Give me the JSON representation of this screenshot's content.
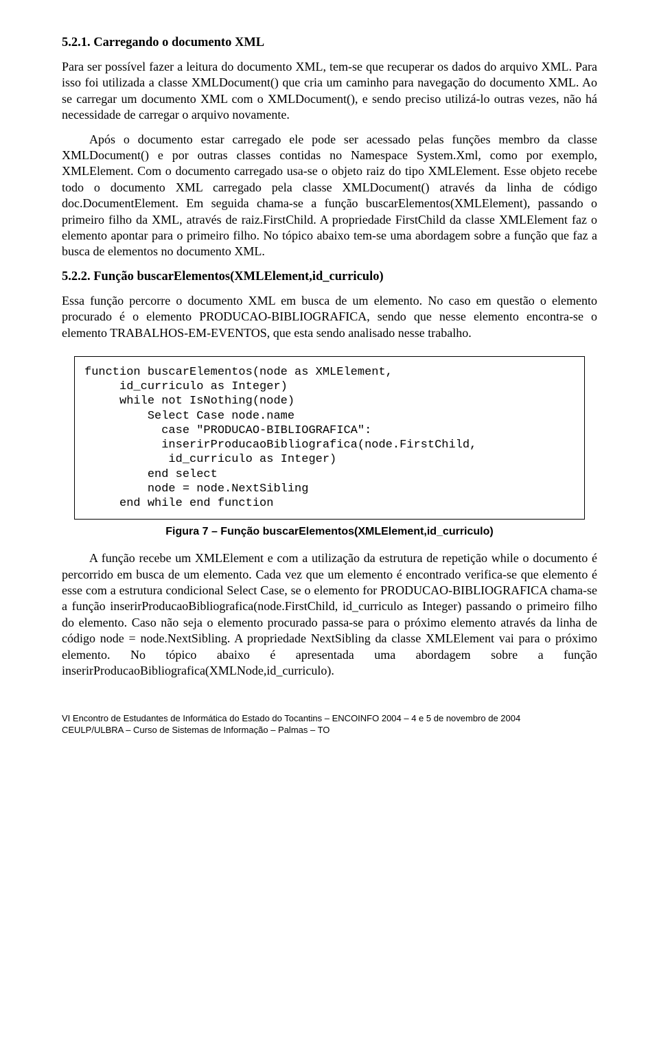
{
  "sec521": {
    "title": "5.2.1. Carregando o documento XML",
    "p1": "Para ser possível fazer a leitura do documento XML, tem-se que recuperar os dados do arquivo XML. Para isso foi utilizada a classe XMLDocument() que cria um caminho para navegação do documento XML. Ao se carregar um documento XML com o XMLDocument(), e sendo preciso utilizá-lo outras vezes, não há necessidade de carregar o arquivo novamente.",
    "p2": "Após o documento estar carregado ele pode ser acessado pelas funções membro da classe XMLDocument() e por outras classes contidas no Namespace System.Xml, como por exemplo, XMLElement. Com o documento carregado usa-se o objeto raiz do tipo XMLElement. Esse objeto recebe todo o documento XML carregado pela classe XMLDocument() através da linha de código doc.DocumentElement. Em seguida chama-se a função buscarElementos(XMLElement), passando o primeiro filho da XML, através de raiz.FirstChild. A propriedade FirstChild da classe XMLElement faz o elemento apontar para o primeiro filho. No tópico abaixo tem-se uma abordagem sobre a função que faz a busca de elementos no documento XML."
  },
  "sec522": {
    "title": "5.2.2. Função buscarElementos(XMLElement,id_curriculo)",
    "p1": "Essa função percorre o documento XML em busca de um elemento. No caso em questão o elemento procurado é o elemento PRODUCAO-BIBLIOGRAFICA, sendo que nesse elemento encontra-se o elemento TRABALHOS-EM-EVENTOS, que esta sendo analisado nesse trabalho.",
    "code": "function buscarElementos(node as XMLElement,\n     id_curriculo as Integer)\n     while not IsNothing(node)\n         Select Case node.name\n           case \"PRODUCAO-BIBLIOGRAFICA\":\n           inserirProducaoBibliografica(node.FirstChild,\n            id_curriculo as Integer)\n         end select\n         node = node.NextSibling\n     end while end function",
    "caption": "Figura 7 – Função buscarElementos(XMLElement,id_curriculo)",
    "p2": "A função recebe um XMLElement e com a utilização da estrutura de repetição while o documento é percorrido em busca de um elemento. Cada vez que um elemento é encontrado verifica-se que elemento é esse com a estrutura condicional Select Case, se o elemento for PRODUCAO-BIBLIOGRAFICA chama-se a função inserirProducaoBibliografica(node.FirstChild, id_curriculo as Integer) passando o primeiro filho do elemento. Caso não seja o elemento procurado passa-se para o próximo elemento através da linha de código node = node.NextSibling. A propriedade NextSibling da classe XMLElement vai para o próximo elemento. No tópico abaixo é apresentada uma abordagem sobre a função inserirProducaoBibliografica(XMLNode,id_curriculo)."
  },
  "footer": {
    "line1": "VI Encontro de Estudantes de Informática do Estado do Tocantins – ENCOINFO 2004 – 4 e 5 de novembro de 2004",
    "line2": "CEULP/ULBRA – Curso de Sistemas de Informação – Palmas – TO"
  }
}
